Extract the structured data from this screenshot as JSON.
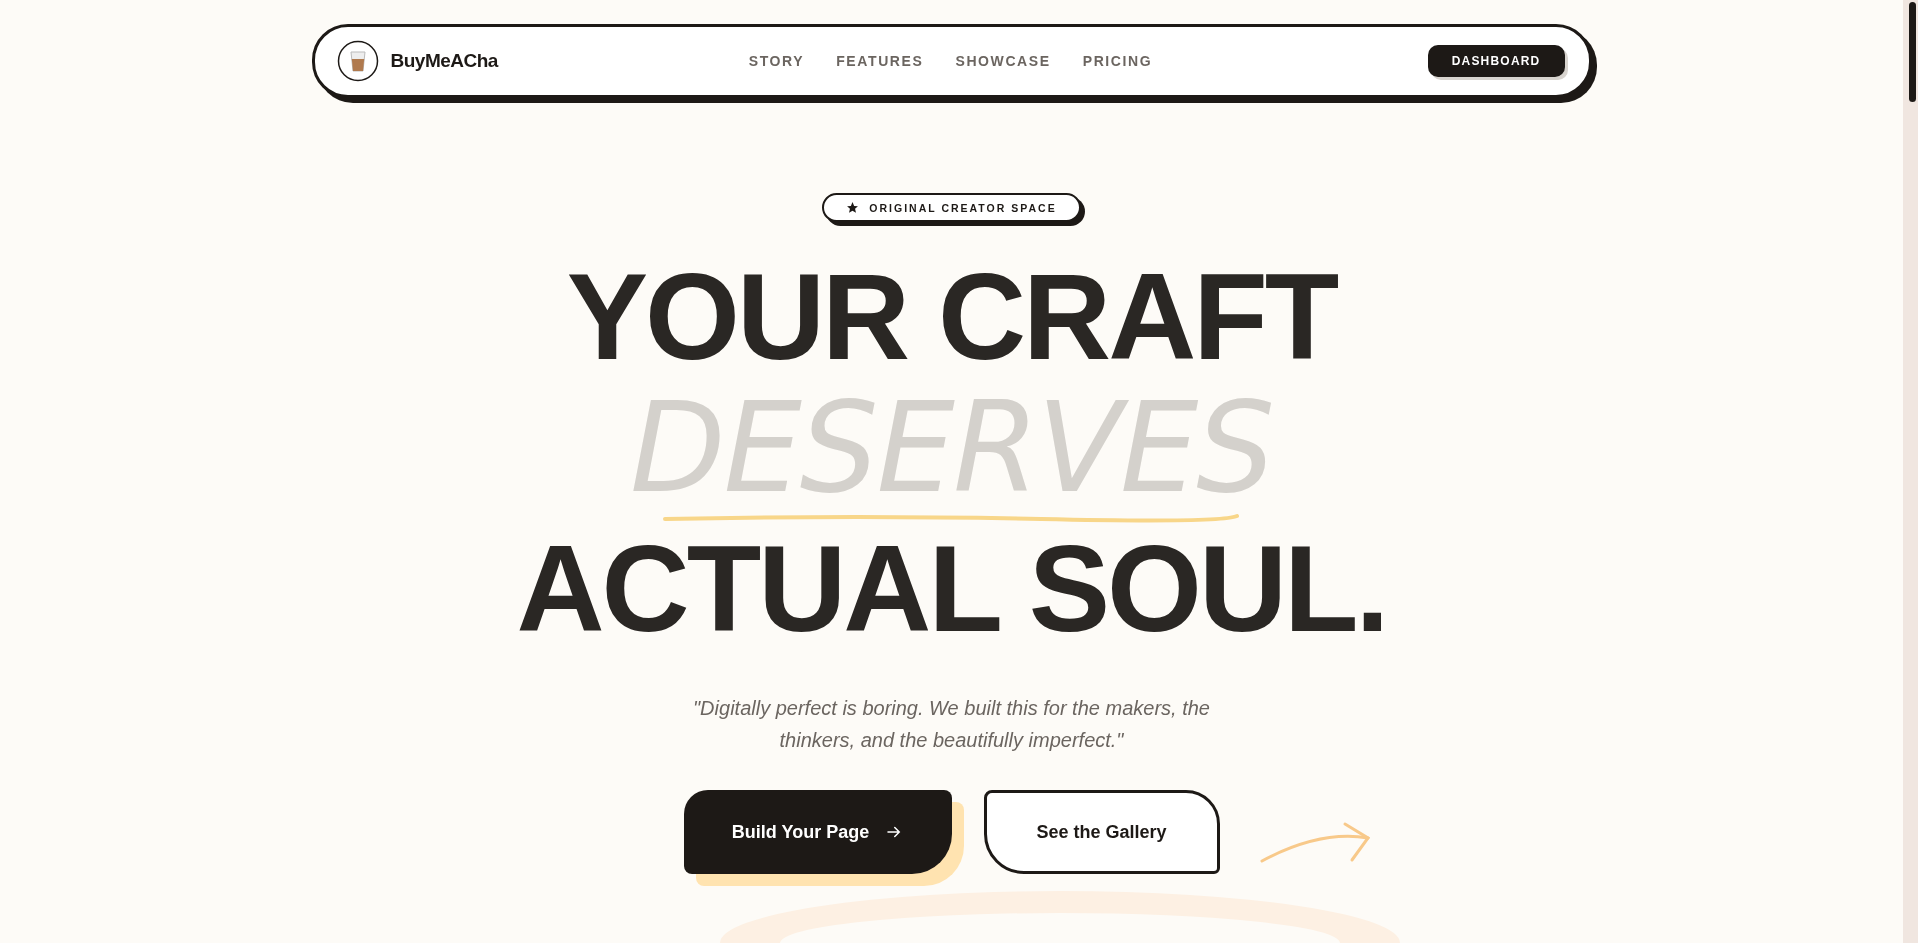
{
  "nav": {
    "brand": "BuyMeACha",
    "links": [
      {
        "label": "STORY"
      },
      {
        "label": "FEATURES"
      },
      {
        "label": "SHOWCASE"
      },
      {
        "label": "PRICING"
      }
    ],
    "cta": "DASHBOARD"
  },
  "hero": {
    "badge": "ORIGINAL CREATOR SPACE",
    "lines": [
      {
        "text": "YOUR CRAFT",
        "kind": "bold"
      },
      {
        "text": "DESERVES",
        "kind": "light"
      },
      {
        "text": "ACTUAL SOUL.",
        "kind": "bold"
      }
    ],
    "quote": "\"Digitally perfect is boring. We built this for the makers, the thinkers, and the beautifully imperfect.\"",
    "buttons": [
      {
        "label": "Build Your Page",
        "kind": "primary"
      },
      {
        "label": "See the Gallery",
        "kind": "secondary"
      }
    ]
  }
}
